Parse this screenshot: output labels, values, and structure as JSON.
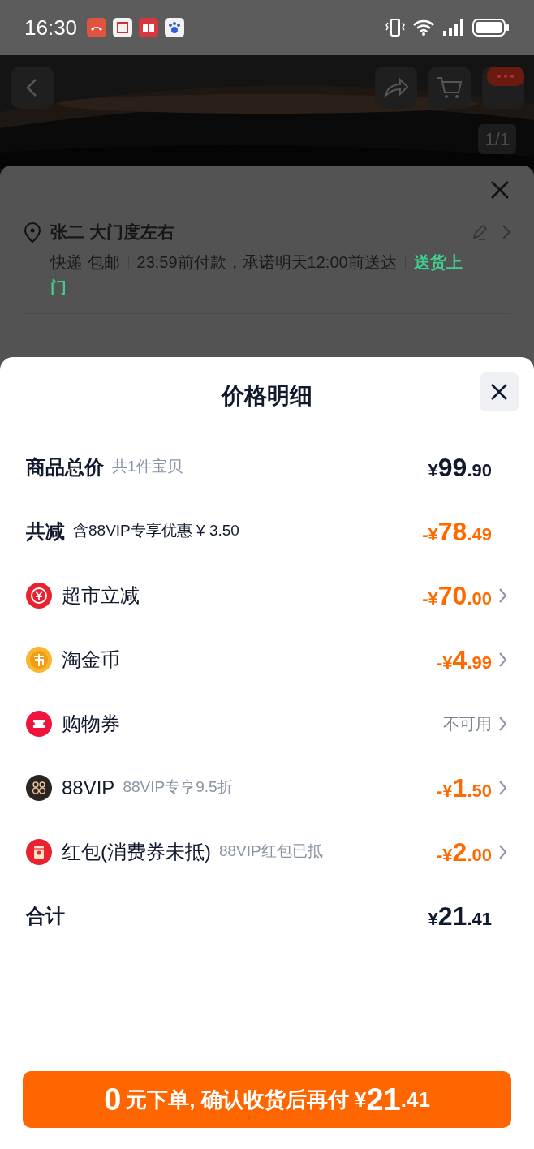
{
  "status_bar": {
    "time": "16:30"
  },
  "background": {
    "image_counter": "1/1",
    "address": {
      "name": "张二 大门度左右",
      "delivery": [
        "快递 包邮",
        "23:59前付款，承诺明天12:00前送达"
      ],
      "delivery_highlight": "送货上门"
    }
  },
  "sheet": {
    "title": "价格明细",
    "rows": [
      {
        "kind": "summary",
        "label": "商品总价",
        "note": "共1件宝贝",
        "value": "¥99.90",
        "color": "#11192d"
      },
      {
        "kind": "summary",
        "label": "共减",
        "note": "含88VIP专享优惠 ¥ 3.50",
        "value": "-¥78.49",
        "color": "#ff6a00"
      },
      {
        "kind": "item",
        "label": "超市立减",
        "value": "-¥70.00",
        "color": "#ff6a00"
      },
      {
        "kind": "item",
        "label": "淘金币",
        "value": "-¥4.99",
        "color": "#ff6a00"
      },
      {
        "kind": "item",
        "label": "购物券",
        "value": "不可用",
        "color": "#7d8594"
      },
      {
        "kind": "item",
        "label": "88VIP",
        "note": "88VIP专享9.5折",
        "value": "-¥1.50",
        "color": "#ff6a00"
      },
      {
        "kind": "item",
        "label": "红包(消费券未抵)",
        "note": "88VIP红包已抵",
        "value": "-¥2.00",
        "color": "#ff6a00"
      },
      {
        "kind": "summary",
        "label": "合计",
        "value": "¥21.41",
        "color": "#11192d"
      }
    ],
    "button": {
      "lead": "0",
      "middle": "元下单, 确认收货后再付 ¥",
      "amount": "21.41"
    }
  }
}
